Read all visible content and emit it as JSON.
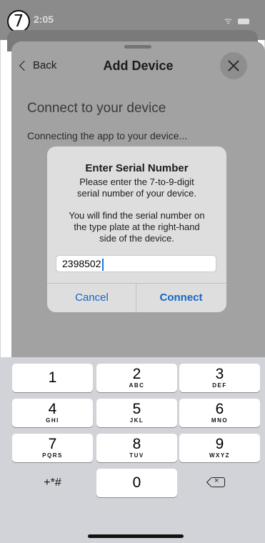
{
  "step_badge": "7",
  "status": {
    "time": "2:05"
  },
  "sheet": {
    "back_label": "Back",
    "title": "Add Device",
    "heading": "Connect to your device",
    "subtext": "Connecting the app to your device..."
  },
  "dialog": {
    "title": "Enter Serial Number",
    "message_line1": "Please enter the 7-to-9-digit",
    "message_line2": "serial number of your device.",
    "hint_line1": "You will find the serial number on",
    "hint_line2": "the type plate at the right-hand",
    "hint_line3": "side of the device.",
    "input_value": "2398502",
    "cancel_label": "Cancel",
    "connect_label": "Connect"
  },
  "keypad": {
    "keys": [
      {
        "num": "1",
        "letters": ""
      },
      {
        "num": "2",
        "letters": "ABC"
      },
      {
        "num": "3",
        "letters": "DEF"
      },
      {
        "num": "4",
        "letters": "GHI"
      },
      {
        "num": "5",
        "letters": "JKL"
      },
      {
        "num": "6",
        "letters": "MNO"
      },
      {
        "num": "7",
        "letters": "PQRS"
      },
      {
        "num": "8",
        "letters": "TUV"
      },
      {
        "num": "9",
        "letters": "WXYZ"
      }
    ],
    "symbols_label": "+*#",
    "zero": "0",
    "delete_glyph": "×"
  },
  "colors": {
    "accent": "#1366c6",
    "overlay": "#a2a2a2"
  }
}
